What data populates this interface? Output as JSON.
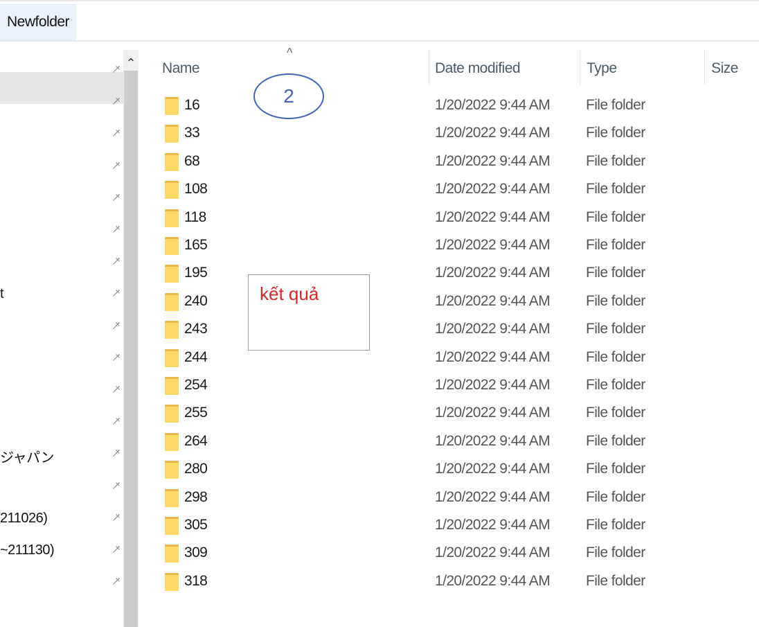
{
  "address": {
    "crumb": "Newfolder"
  },
  "nav": {
    "items": [
      {
        "label": ""
      },
      {
        "label": ""
      },
      {
        "label": ""
      },
      {
        "label": ""
      },
      {
        "label": ""
      },
      {
        "label": ""
      },
      {
        "label": ""
      },
      {
        "label": "t"
      },
      {
        "label": ""
      },
      {
        "label": ""
      },
      {
        "label": ""
      },
      {
        "label": ""
      },
      {
        "label": "ジャパン"
      },
      {
        "label": ""
      },
      {
        "label": "211026)"
      },
      {
        "label": "~211130)"
      },
      {
        "label": ""
      }
    ]
  },
  "columns": {
    "name": "Name",
    "date": "Date modified",
    "type": "Type",
    "size": "Size"
  },
  "sort_caret": "^",
  "rows": [
    {
      "name": "16",
      "date": "1/20/2022 9:44 AM",
      "type": "File folder"
    },
    {
      "name": "33",
      "date": "1/20/2022 9:44 AM",
      "type": "File folder"
    },
    {
      "name": "68",
      "date": "1/20/2022 9:44 AM",
      "type": "File folder"
    },
    {
      "name": "108",
      "date": "1/20/2022 9:44 AM",
      "type": "File folder"
    },
    {
      "name": "118",
      "date": "1/20/2022 9:44 AM",
      "type": "File folder"
    },
    {
      "name": "165",
      "date": "1/20/2022 9:44 AM",
      "type": "File folder"
    },
    {
      "name": "195",
      "date": "1/20/2022 9:44 AM",
      "type": "File folder"
    },
    {
      "name": "240",
      "date": "1/20/2022 9:44 AM",
      "type": "File folder"
    },
    {
      "name": "243",
      "date": "1/20/2022 9:44 AM",
      "type": "File folder"
    },
    {
      "name": "244",
      "date": "1/20/2022 9:44 AM",
      "type": "File folder"
    },
    {
      "name": "254",
      "date": "1/20/2022 9:44 AM",
      "type": "File folder"
    },
    {
      "name": "255",
      "date": "1/20/2022 9:44 AM",
      "type": "File folder"
    },
    {
      "name": "264",
      "date": "1/20/2022 9:44 AM",
      "type": "File folder"
    },
    {
      "name": "280",
      "date": "1/20/2022 9:44 AM",
      "type": "File folder"
    },
    {
      "name": "298",
      "date": "1/20/2022 9:44 AM",
      "type": "File folder"
    },
    {
      "name": "305",
      "date": "1/20/2022 9:44 AM",
      "type": "File folder"
    },
    {
      "name": "309",
      "date": "1/20/2022 9:44 AM",
      "type": "File folder"
    },
    {
      "name": "318",
      "date": "1/20/2022 9:44 AM",
      "type": "File folder"
    }
  ],
  "annotations": {
    "circle_label": "2",
    "note": "kết quả"
  },
  "colors": {
    "folder": "#ffd968",
    "annotation_blue": "#3f66b5",
    "annotation_red": "#d62a2a"
  }
}
